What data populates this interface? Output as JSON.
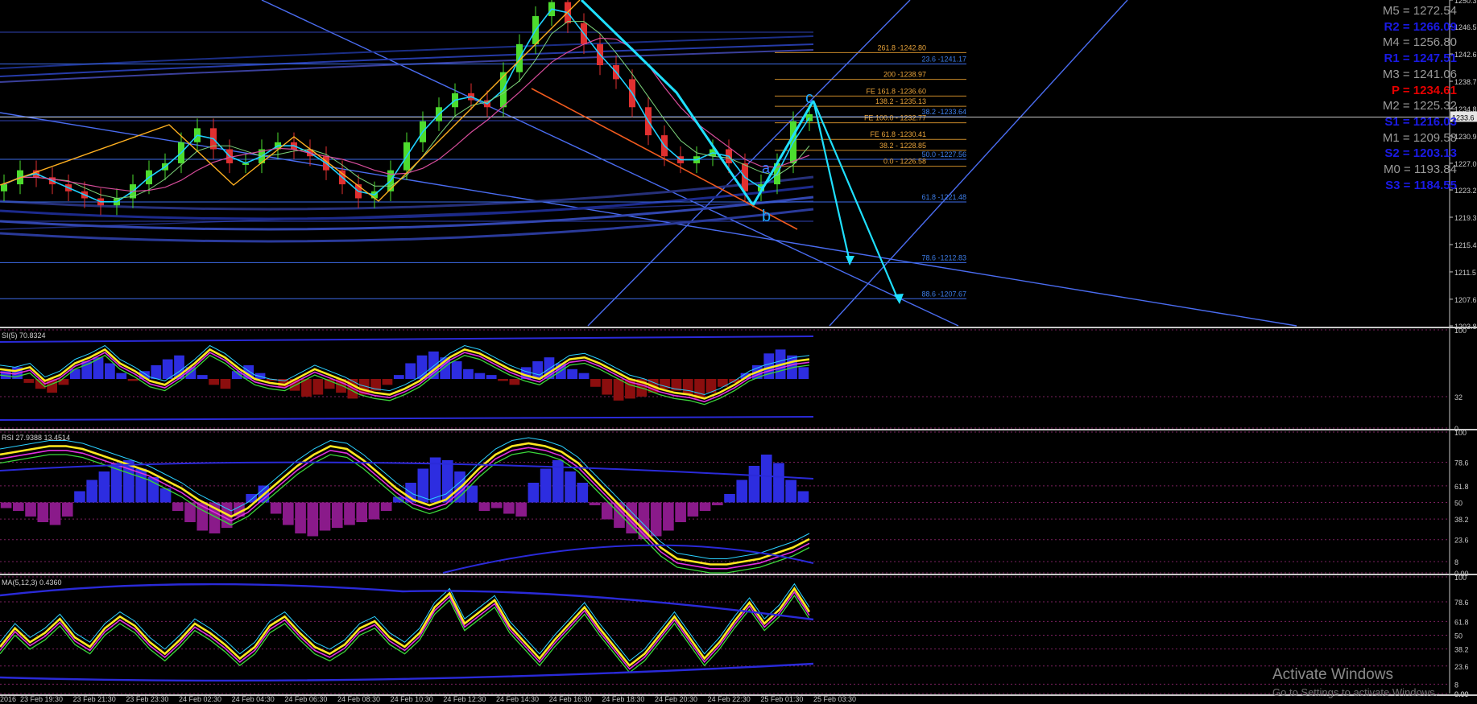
{
  "chart_data": {
    "type": "line",
    "instrument_scale": {
      "ylim": [
        1203.8,
        1250.3
      ],
      "y_ticks": [
        "1250.3",
        "1246.5",
        "1242.6",
        "1238.7",
        "1234.8",
        "1230.9",
        "1227.0",
        "1223.2",
        "1219.3",
        "1215.4",
        "1211.5",
        "1207.6",
        "1203.8"
      ],
      "current_price_label": "1233.6"
    },
    "x_ticks": [
      "2016",
      "23 Feb 19:30",
      "23 Feb 21:30",
      "23 Feb 23:30",
      "24 Feb 02:30",
      "24 Feb 04:30",
      "24 Feb 06:30",
      "24 Feb 08:30",
      "24 Feb 10:30",
      "24 Feb 12:30",
      "24 Feb 14:30",
      "24 Feb 16:30",
      "24 Feb 18:30",
      "24 Feb 20:30",
      "24 Feb 22:30",
      "25 Feb 01:30",
      "25 Feb 03:30"
    ],
    "pivot_levels": [
      {
        "label": "M5 = 1272.54",
        "color": "#9a9a9a"
      },
      {
        "label": "R2 = 1266.09",
        "color": "#1a1ae6"
      },
      {
        "label": "M4 = 1256.80",
        "color": "#9a9a9a"
      },
      {
        "label": "R1 = 1247.51",
        "color": "#1a1ae6"
      },
      {
        "label": "M3 = 1241.06",
        "color": "#9a9a9a"
      },
      {
        "label": "P = 1234.61",
        "color": "#e60000"
      },
      {
        "label": "M2 = 1225.32",
        "color": "#9a9a9a"
      },
      {
        "label": "S1 = 1216.03",
        "color": "#1a1ae6"
      },
      {
        "label": "M1 = 1209.58",
        "color": "#9a9a9a"
      },
      {
        "label": "S2 = 1203.13",
        "color": "#1a1ae6"
      },
      {
        "label": "M0 = 1193.84",
        "color": "#9a9a9a"
      },
      {
        "label": "S3 = 1184.55",
        "color": "#1a1ae6"
      }
    ],
    "fib_levels": [
      {
        "label": "261.8 -1242.80",
        "value": 1242.8,
        "color": "#e8a33a"
      },
      {
        "label": "23.6 -1241.17",
        "value": 1241.17,
        "color": "#3d7de8"
      },
      {
        "label": "200 -1238.97",
        "value": 1238.97,
        "color": "#e8a33a"
      },
      {
        "label": "FE 161.8 -1236.60",
        "value": 1236.6,
        "color": "#e8a33a"
      },
      {
        "label": "138.2 - 1235.13",
        "value": 1235.13,
        "color": "#e8a33a"
      },
      {
        "label": "38.2 -1233.64",
        "value": 1233.64,
        "color": "#3d7de8"
      },
      {
        "label": "FE 100.0 - 1232.77",
        "value": 1232.77,
        "color": "#e8a33a"
      },
      {
        "label": "FE 61.8 -1230.41",
        "value": 1230.41,
        "color": "#e8a33a"
      },
      {
        "label": "38.2 - 1228.85",
        "value": 1228.85,
        "color": "#e8a33a"
      },
      {
        "label": "50.0 -1227.56",
        "value": 1227.56,
        "color": "#3d7de8"
      },
      {
        "label": "0.0 - 1226.58",
        "value": 1226.58,
        "color": "#e8a33a"
      },
      {
        "label": "61.8 -1221.48",
        "value": 1221.48,
        "color": "#3d7de8"
      },
      {
        "label": "78.6 -1212.83",
        "value": 1212.83,
        "color": "#3d7de8"
      },
      {
        "label": "88.6 -1207.67",
        "value": 1207.67,
        "color": "#3d7de8"
      }
    ],
    "pattern_points": [
      "a",
      "b",
      "c"
    ],
    "price_close": [
      1224,
      1226,
      1225,
      1224,
      1223,
      1222,
      1221,
      1222,
      1224,
      1226,
      1227,
      1230,
      1232,
      1229,
      1227,
      1227,
      1229,
      1230,
      1229,
      1228,
      1226,
      1224,
      1222,
      1223,
      1226,
      1230,
      1233,
      1235,
      1237,
      1236,
      1235,
      1240,
      1244,
      1248,
      1250,
      1247,
      1244,
      1241,
      1239,
      1235,
      1231,
      1228,
      1227,
      1228,
      1229,
      1227,
      1223,
      1224,
      1227,
      1233,
      1234
    ],
    "panels": [
      {
        "title": "SI(5) 70.8324",
        "ylim": [
          0,
          100
        ],
        "y_ticks": [
          "100",
          "32",
          "0"
        ],
        "histogram": [
          8,
          12,
          -4,
          -10,
          -14,
          -6,
          10,
          18,
          22,
          16,
          6,
          -2,
          8,
          14,
          20,
          24,
          12,
          4,
          -6,
          -10,
          8,
          14,
          6,
          -2,
          -8,
          -12,
          -18,
          -16,
          -10,
          -14,
          -20,
          -16,
          -12,
          -6,
          4,
          16,
          24,
          28,
          22,
          18,
          10,
          6,
          4,
          -2,
          -6,
          12,
          18,
          22,
          16,
          10,
          6,
          -8,
          -16,
          -22,
          -20,
          -18,
          -14,
          -10,
          -12,
          -16,
          -20,
          -14,
          -8,
          -4,
          6,
          14,
          26,
          30,
          24,
          12
        ],
        "main_line": [
          60,
          58,
          62,
          48,
          54,
          66,
          72,
          80,
          66,
          58,
          48,
          44,
          54,
          66,
          80,
          72,
          60,
          50,
          46,
          44,
          52,
          60,
          54,
          48,
          40,
          36,
          34,
          40,
          48,
          60,
          72,
          80,
          76,
          68,
          60,
          54,
          50,
          60,
          70,
          72,
          66,
          58,
          50,
          46,
          40,
          36,
          34,
          30,
          36,
          44,
          54,
          60,
          64,
          68,
          70
        ]
      },
      {
        "title": "RSI 27.9388 13.4514",
        "ylim": [
          0,
          100
        ],
        "y_ticks": [
          "100",
          "78.6",
          "61.8",
          "50",
          "38.2",
          "23.6",
          "8",
          "0.00"
        ],
        "histogram": [
          -4,
          -6,
          -10,
          -14,
          -16,
          -10,
          8,
          16,
          22,
          28,
          30,
          24,
          18,
          10,
          -6,
          -14,
          -20,
          -22,
          -18,
          -10,
          6,
          12,
          -8,
          -16,
          -22,
          -24,
          -20,
          -18,
          -16,
          -14,
          -12,
          -6,
          4,
          14,
          24,
          32,
          30,
          22,
          12,
          -6,
          -4,
          -8,
          -10,
          14,
          24,
          30,
          22,
          14,
          -2,
          -12,
          -18,
          -22,
          -26,
          -24,
          -20,
          -14,
          -10,
          -6,
          -2,
          6,
          16,
          26,
          34,
          28,
          16,
          8
        ],
        "main_line": [
          84,
          86,
          88,
          90,
          90,
          88,
          84,
          80,
          76,
          72,
          66,
          60,
          52,
          46,
          40,
          46,
          56,
          66,
          76,
          84,
          90,
          88,
          80,
          70,
          60,
          52,
          48,
          52,
          62,
          74,
          84,
          90,
          92,
          90,
          86,
          78,
          66,
          54,
          42,
          30,
          18,
          10,
          8,
          6,
          6,
          8,
          10,
          14,
          18,
          24
        ]
      },
      {
        "title": "MA(5,12,3) 0.4360",
        "ylim": [
          0,
          100
        ],
        "y_ticks": [
          "100",
          "78.6",
          "61.8",
          "50",
          "0.00",
          "38.2",
          "23.6",
          "8",
          "0.00"
        ],
        "main_line": [
          40,
          56,
          44,
          52,
          64,
          48,
          40,
          56,
          66,
          58,
          44,
          34,
          46,
          60,
          52,
          42,
          30,
          40,
          58,
          66,
          52,
          40,
          34,
          42,
          56,
          62,
          48,
          40,
          52,
          74,
          86,
          60,
          70,
          80,
          58,
          44,
          30,
          46,
          60,
          74,
          56,
          40,
          24,
          34,
          50,
          66,
          48,
          30,
          44,
          62,
          78,
          60,
          72,
          90,
          70
        ]
      }
    ]
  },
  "watermark": {
    "title": "Activate Windows",
    "subtitle": "Go to Settings to activate Windows."
  }
}
